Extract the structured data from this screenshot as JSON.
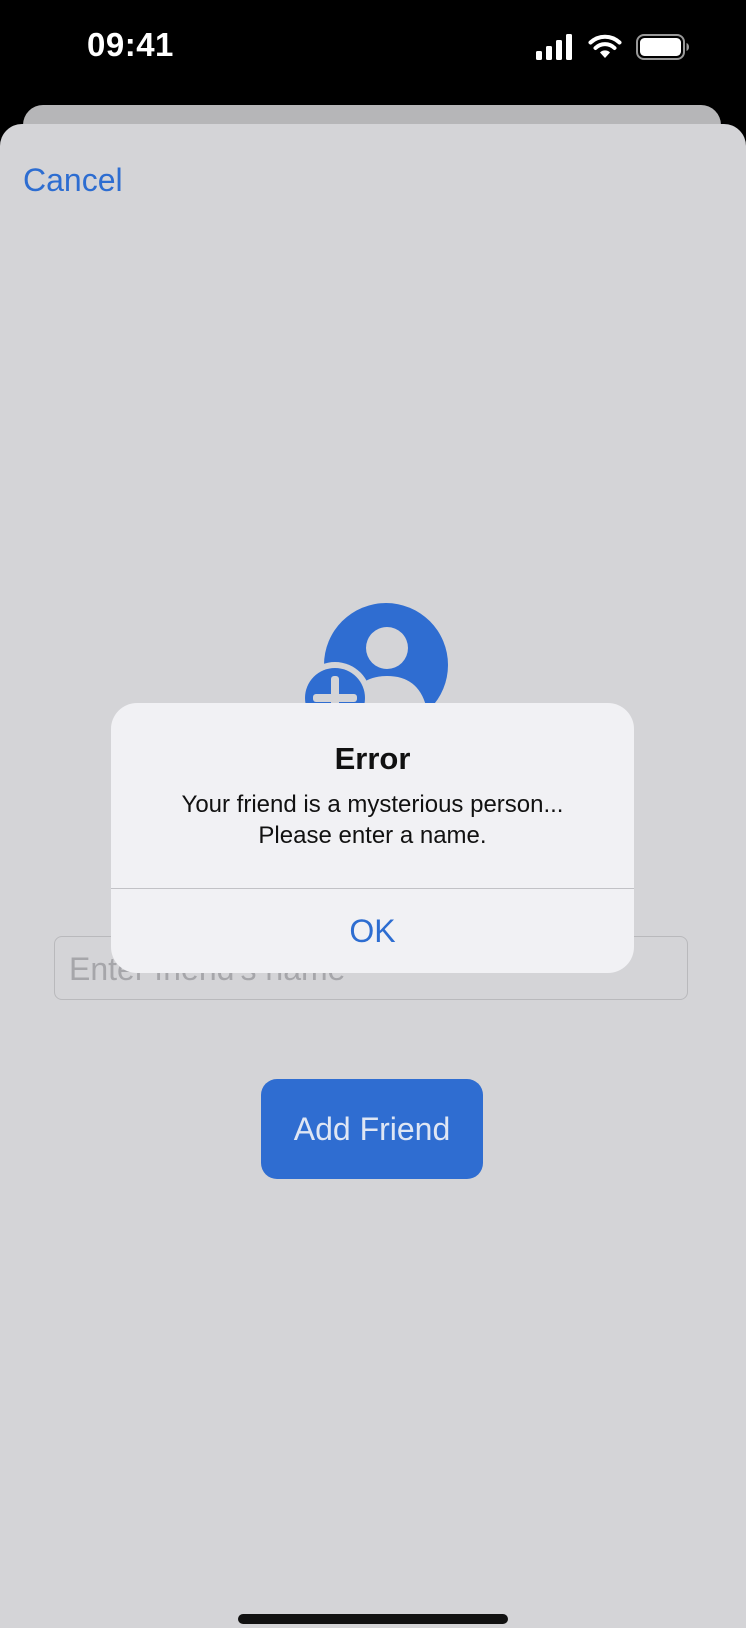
{
  "status_bar": {
    "time": "09:41",
    "icons": [
      "cellular-signal-icon",
      "wifi-icon",
      "battery-icon"
    ]
  },
  "sheet": {
    "cancel_label": "Cancel",
    "avatar_icon": "person-add-icon",
    "name_input": {
      "value": "",
      "placeholder": "Enter friend's name"
    },
    "add_button_label": "Add Friend"
  },
  "alert": {
    "title": "Error",
    "message_line1": "Your friend is a mysterious person...",
    "message_line2": "Please enter a name.",
    "ok_label": "OK"
  },
  "colors": {
    "accent": "#2d6dd1",
    "sheet_background": "#d4d4d7",
    "alert_background": "#f1f1f4"
  }
}
